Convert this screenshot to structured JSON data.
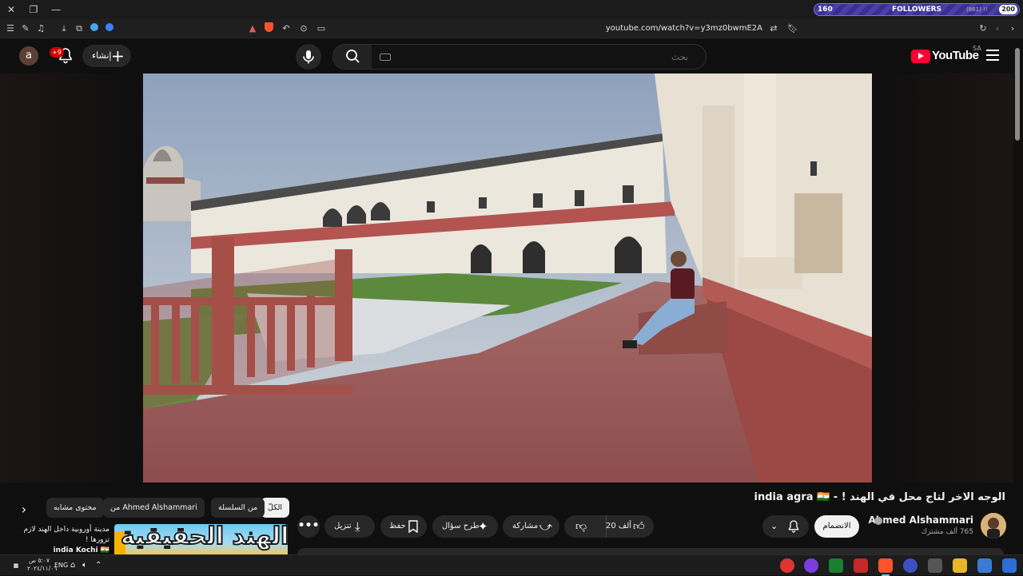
{
  "browser": {
    "url": "youtube.com/watch?v=y3mz0bwmE2A",
    "followers_widget": {
      "left_count": "160",
      "label": "FOLLOWERS",
      "sub": "(861) !!",
      "right_count": "200"
    }
  },
  "header": {
    "avatar_letter": "a",
    "notifications_badge": "+9",
    "create_label": "إنشاء",
    "search_placeholder": "بحث",
    "logo_text": "YouTube",
    "country_code": "SA"
  },
  "video": {
    "title": "الوجه الاخر لتاج محل في الهند ! - india agra 🇮🇳",
    "channel_name": "Ahmed Alshammari",
    "subscribers": "765 ألف مشترك",
    "join_label": "الانضمام",
    "likes": "20 ألف",
    "share_label": "مشاركة",
    "ask_label": "طرح سؤال",
    "save_label": "حفظ",
    "download_label": "تنزيل"
  },
  "chips": {
    "all": "الكلّ",
    "from_series": "من السلسلة",
    "from_channel": "من Ahmed Alshammari",
    "related": "محتوى مشابه"
  },
  "recommendation": {
    "thumb_text": "الهند الحقيقية!",
    "title_line": "مدينة أوروبية داخل الهند لازم تزورها !",
    "title_tag": "india Kochi 🇮🇳"
  },
  "taskbar": {
    "lang": "ENG",
    "time": "٥:٠٧ ص",
    "date": "٢٠٢٤/١١/٠٦"
  },
  "colors": {
    "brand_red": "#ff0033",
    "background": "#0f0f0f",
    "pill_bg": "#272727"
  }
}
